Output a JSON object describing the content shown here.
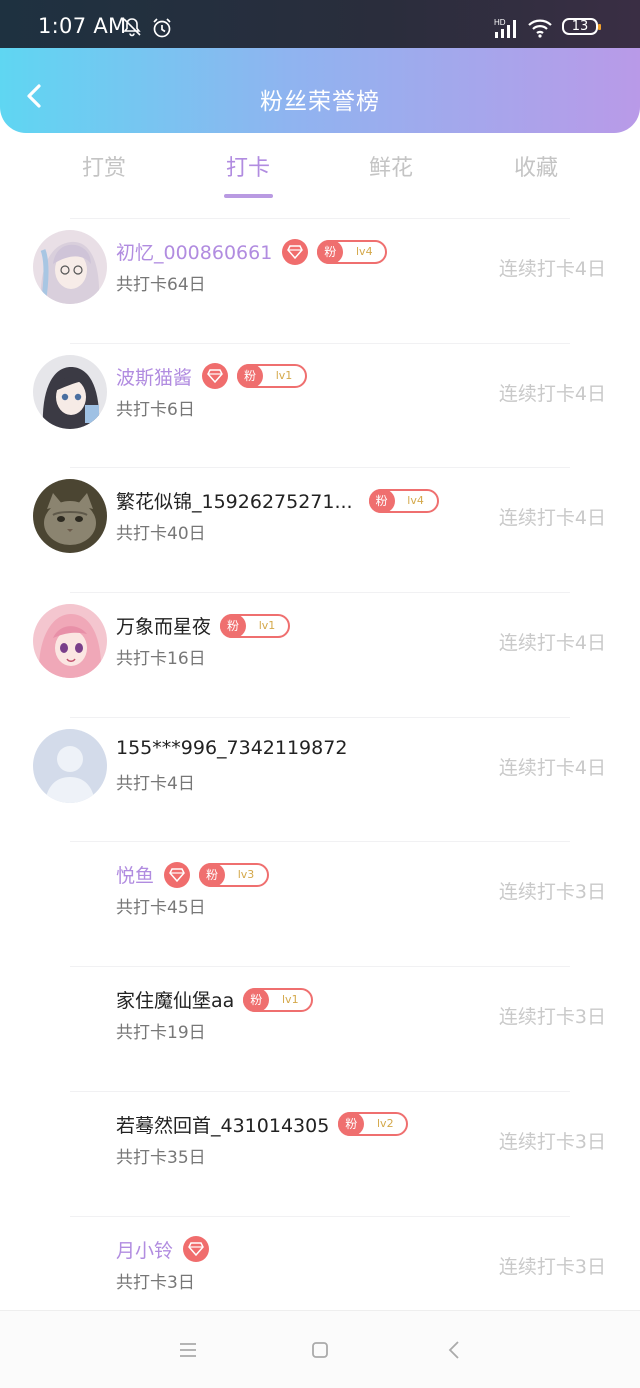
{
  "status_bar": {
    "time": "1:07 AM",
    "battery": "13"
  },
  "header": {
    "title": "粉丝荣誉榜"
  },
  "tabs": [
    {
      "label": "打赏",
      "active": false
    },
    {
      "label": "打卡",
      "active": true
    },
    {
      "label": "鲜花",
      "active": false
    },
    {
      "label": "收藏",
      "active": false
    }
  ],
  "colors": {
    "accent": "#b18ce0",
    "badge": "#ef6f6f",
    "gradient_start": "#5fd6f2",
    "gradient_end": "#b99ae8"
  },
  "rows": [
    {
      "name": "初忆_000860661",
      "vip": true,
      "gem": true,
      "fan_label": "粉",
      "level": "lv4",
      "total": "共打卡64日",
      "streak": "连续打卡4日",
      "avatar": "anime-girl-glasses"
    },
    {
      "name": "波斯猫酱",
      "vip": true,
      "gem": true,
      "fan_label": "粉",
      "level": "lv1",
      "total": "共打卡6日",
      "streak": "连续打卡4日",
      "avatar": "anime-girl-dark-hair"
    },
    {
      "name": "繁花似锦_15926275271...",
      "vip": false,
      "gem": false,
      "fan_label": "粉",
      "level": "lv4",
      "total": "共打卡40日",
      "streak": "连续打卡4日",
      "avatar": "cat-photo"
    },
    {
      "name": "万象而星夜",
      "vip": false,
      "gem": false,
      "fan_label": "粉",
      "level": "lv1",
      "total": "共打卡16日",
      "streak": "连续打卡4日",
      "avatar": "anime-girl-pink"
    },
    {
      "name": "155***996_7342119872",
      "vip": false,
      "gem": false,
      "fan_label": "",
      "level": "",
      "total": "共打卡4日",
      "streak": "连续打卡4日",
      "avatar": "default-user"
    },
    {
      "name": "悦鱼",
      "vip": true,
      "gem": true,
      "fan_label": "粉",
      "level": "lv3",
      "total": "共打卡45日",
      "streak": "连续打卡3日",
      "avatar": "none"
    },
    {
      "name": "家住魔仙堡aa",
      "vip": false,
      "gem": false,
      "fan_label": "粉",
      "level": "lv1",
      "total": "共打卡19日",
      "streak": "连续打卡3日",
      "avatar": "none"
    },
    {
      "name": "若蓦然回首_431014305",
      "vip": false,
      "gem": false,
      "fan_label": "粉",
      "level": "lv2",
      "total": "共打卡35日",
      "streak": "连续打卡3日",
      "avatar": "none"
    },
    {
      "name": "月小铃",
      "vip": true,
      "gem": true,
      "fan_label": "",
      "level": "",
      "total": "共打卡3日",
      "streak": "连续打卡3日",
      "avatar": "none"
    }
  ],
  "nav": [
    "menu-icon",
    "home-icon",
    "back-icon"
  ]
}
